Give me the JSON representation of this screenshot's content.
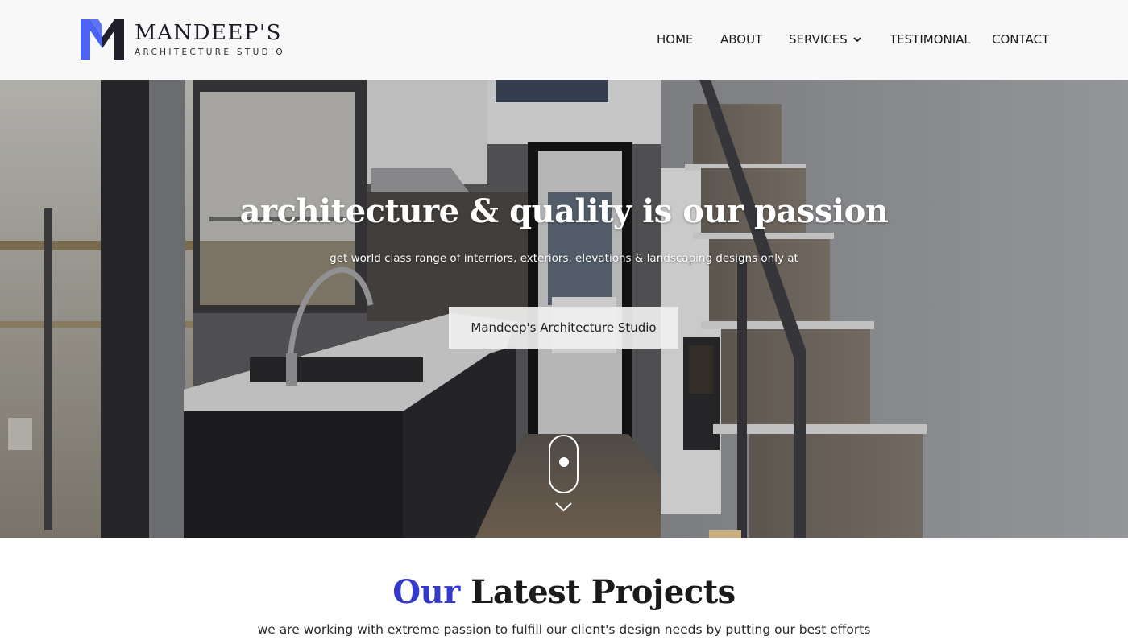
{
  "brand": {
    "name": "MANDEEP'S",
    "tagline": "ARCHITECTURE STUDIO",
    "mark_colors": {
      "primary": "#4b63f0",
      "secondary": "#1f1f2b"
    }
  },
  "nav": {
    "items": [
      {
        "label": "HOME"
      },
      {
        "label": "ABOUT"
      },
      {
        "label": "SERVICES",
        "icon": "chevron-down-icon"
      },
      {
        "label": "TESTIMONIAL"
      },
      {
        "label": "CONTACT"
      }
    ]
  },
  "hero": {
    "title": "architecture & quality is our passion",
    "subtitle": "get world class range of interriors, exteriors, elevations & landscaping designs only at",
    "button_label": "Mandeep's Architecture Studio",
    "scroll_icons": [
      "mouse-scroll-icon",
      "chevron-down-icon"
    ]
  },
  "projects": {
    "title_accent": "Our",
    "title_rest": " Latest Projects",
    "subtitle": "we are working with extreme passion to fulfill our client's design needs by putting our best efforts",
    "accent_color": "#3539c8"
  }
}
